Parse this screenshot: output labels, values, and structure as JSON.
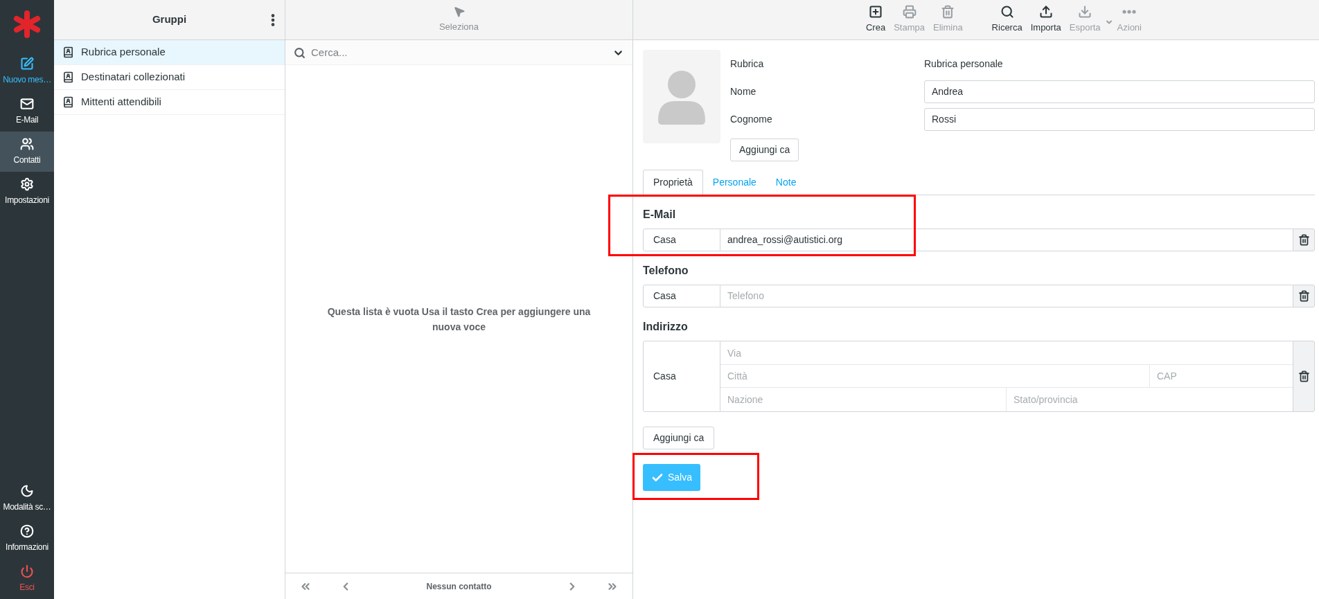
{
  "nav": {
    "top": [
      {
        "kind": "compose",
        "label": "Nuovo mes…",
        "selected": false
      },
      {
        "kind": "mail",
        "label": "E-Mail",
        "selected": false
      },
      {
        "kind": "contacts",
        "label": "Contatti",
        "selected": true
      },
      {
        "kind": "settings",
        "label": "Impostazioni",
        "selected": false
      }
    ],
    "bottom": [
      {
        "kind": "darkmode",
        "label": "Modalità sc…",
        "selected": false
      },
      {
        "kind": "about",
        "label": "Informazioni",
        "selected": false
      },
      {
        "kind": "logout",
        "label": "Esci",
        "selected": false
      }
    ]
  },
  "groups": {
    "title": "Gruppi",
    "items": [
      {
        "label": "Rubrica personale",
        "selected": true
      },
      {
        "label": "Destinatari collezionati",
        "selected": false
      },
      {
        "label": "Mittenti attendibili",
        "selected": false
      }
    ]
  },
  "list": {
    "select_label": "Seleziona",
    "search": {
      "placeholder": "Cerca..."
    },
    "empty_message": "Questa lista è vuota Usa il tasto Crea per aggiungere una nuova voce",
    "pager": {
      "text": "Nessun contatto"
    }
  },
  "toolbar": [
    {
      "kind": "create",
      "label": "Crea",
      "disabled": false
    },
    {
      "kind": "print",
      "label": "Stampa",
      "disabled": true
    },
    {
      "kind": "delete",
      "label": "Elimina",
      "disabled": true
    },
    {
      "kind": "search",
      "label": "Ricerca",
      "disabled": false
    },
    {
      "kind": "import",
      "label": "Importa",
      "disabled": false
    },
    {
      "kind": "export",
      "label": "Esporta",
      "disabled": true
    },
    {
      "kind": "more",
      "label": "Azioni",
      "disabled": true
    }
  ],
  "contact": {
    "head_fields": [
      {
        "kind": "text",
        "label": "Rubrica",
        "value": "Rubrica personale"
      },
      {
        "kind": "input",
        "label": "Nome",
        "value": "Andrea"
      },
      {
        "kind": "input",
        "label": "Cognome",
        "value": "Rossi"
      }
    ],
    "add_field_button": "Aggiungi ca",
    "tabs": [
      {
        "label": "Proprietà",
        "selected": true
      },
      {
        "label": "Personale",
        "selected": false
      },
      {
        "label": "Note",
        "selected": false
      }
    ],
    "sections": [
      {
        "kind": "single",
        "title": "E-Mail",
        "highlighted": true,
        "type_label": "Casa",
        "value": "andrea_rossi@autistici.org"
      },
      {
        "kind": "single",
        "title": "Telefono",
        "highlighted": false,
        "type_label": "Casa",
        "placeholder": "Telefono"
      },
      {
        "kind": "address",
        "title": "Indirizzo",
        "highlighted": false,
        "type_label": "Casa",
        "placeholders": [
          "Via",
          "Città",
          "CAP",
          "Nazione",
          "Stato/provincia"
        ]
      }
    ],
    "add_property_button": "Aggiungi ca",
    "save_button": {
      "label": "Salva",
      "highlighted": true
    }
  }
}
